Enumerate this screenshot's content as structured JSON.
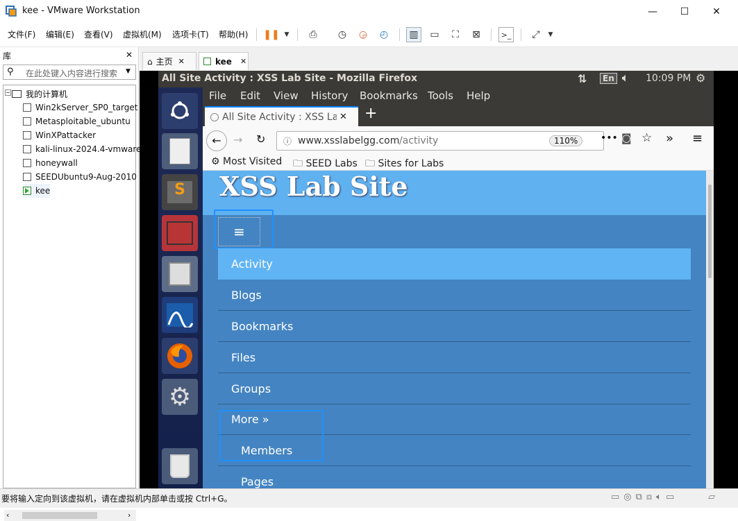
{
  "window": {
    "title": "kee - VMware Workstation",
    "min": "—",
    "max": "☐",
    "close": "✕"
  },
  "menu": {
    "items": [
      "文件(F)",
      "编辑(E)",
      "查看(V)",
      "虚拟机(M)",
      "选项卡(T)",
      "帮助(H)"
    ]
  },
  "library": {
    "title": "库",
    "close": "✕",
    "search_placeholder": "在此处键入内容进行搜索",
    "root": "我的计算机",
    "vms": [
      "Win2kServer_SP0_target",
      "Metasploitable_ubuntu",
      "WinXPattacker",
      "kali-linux-2024.4-vmware",
      "honeywall",
      "SEEDUbuntu9-Aug-2010",
      "kee"
    ]
  },
  "tabs": {
    "home": "主页",
    "vm": "kee"
  },
  "ubuntu": {
    "window_title": "All Site Activity : XSS Lab Site - Mozilla Firefox",
    "lang": "En",
    "time": "10:09 PM"
  },
  "firefox": {
    "menu": [
      "File",
      "Edit",
      "View",
      "History",
      "Bookmarks",
      "Tools",
      "Help"
    ],
    "tab_title": "All Site Activity : XSS Lab",
    "url_domain": "www.xsslabelgg.com",
    "url_path": "/activity",
    "zoom": "110%",
    "bookmarks": [
      "Most Visited",
      "SEED Labs",
      "Sites for Labs"
    ]
  },
  "site": {
    "title": "XSS Lab Site",
    "nav": [
      "Activity",
      "Blogs",
      "Bookmarks",
      "Files",
      "Groups",
      "More  »"
    ],
    "sub": [
      "Members",
      "Pages"
    ]
  },
  "status": {
    "text": "要将输入定向到该虚拟机，请在虚拟机内部单击或按 Ctrl+G。"
  }
}
